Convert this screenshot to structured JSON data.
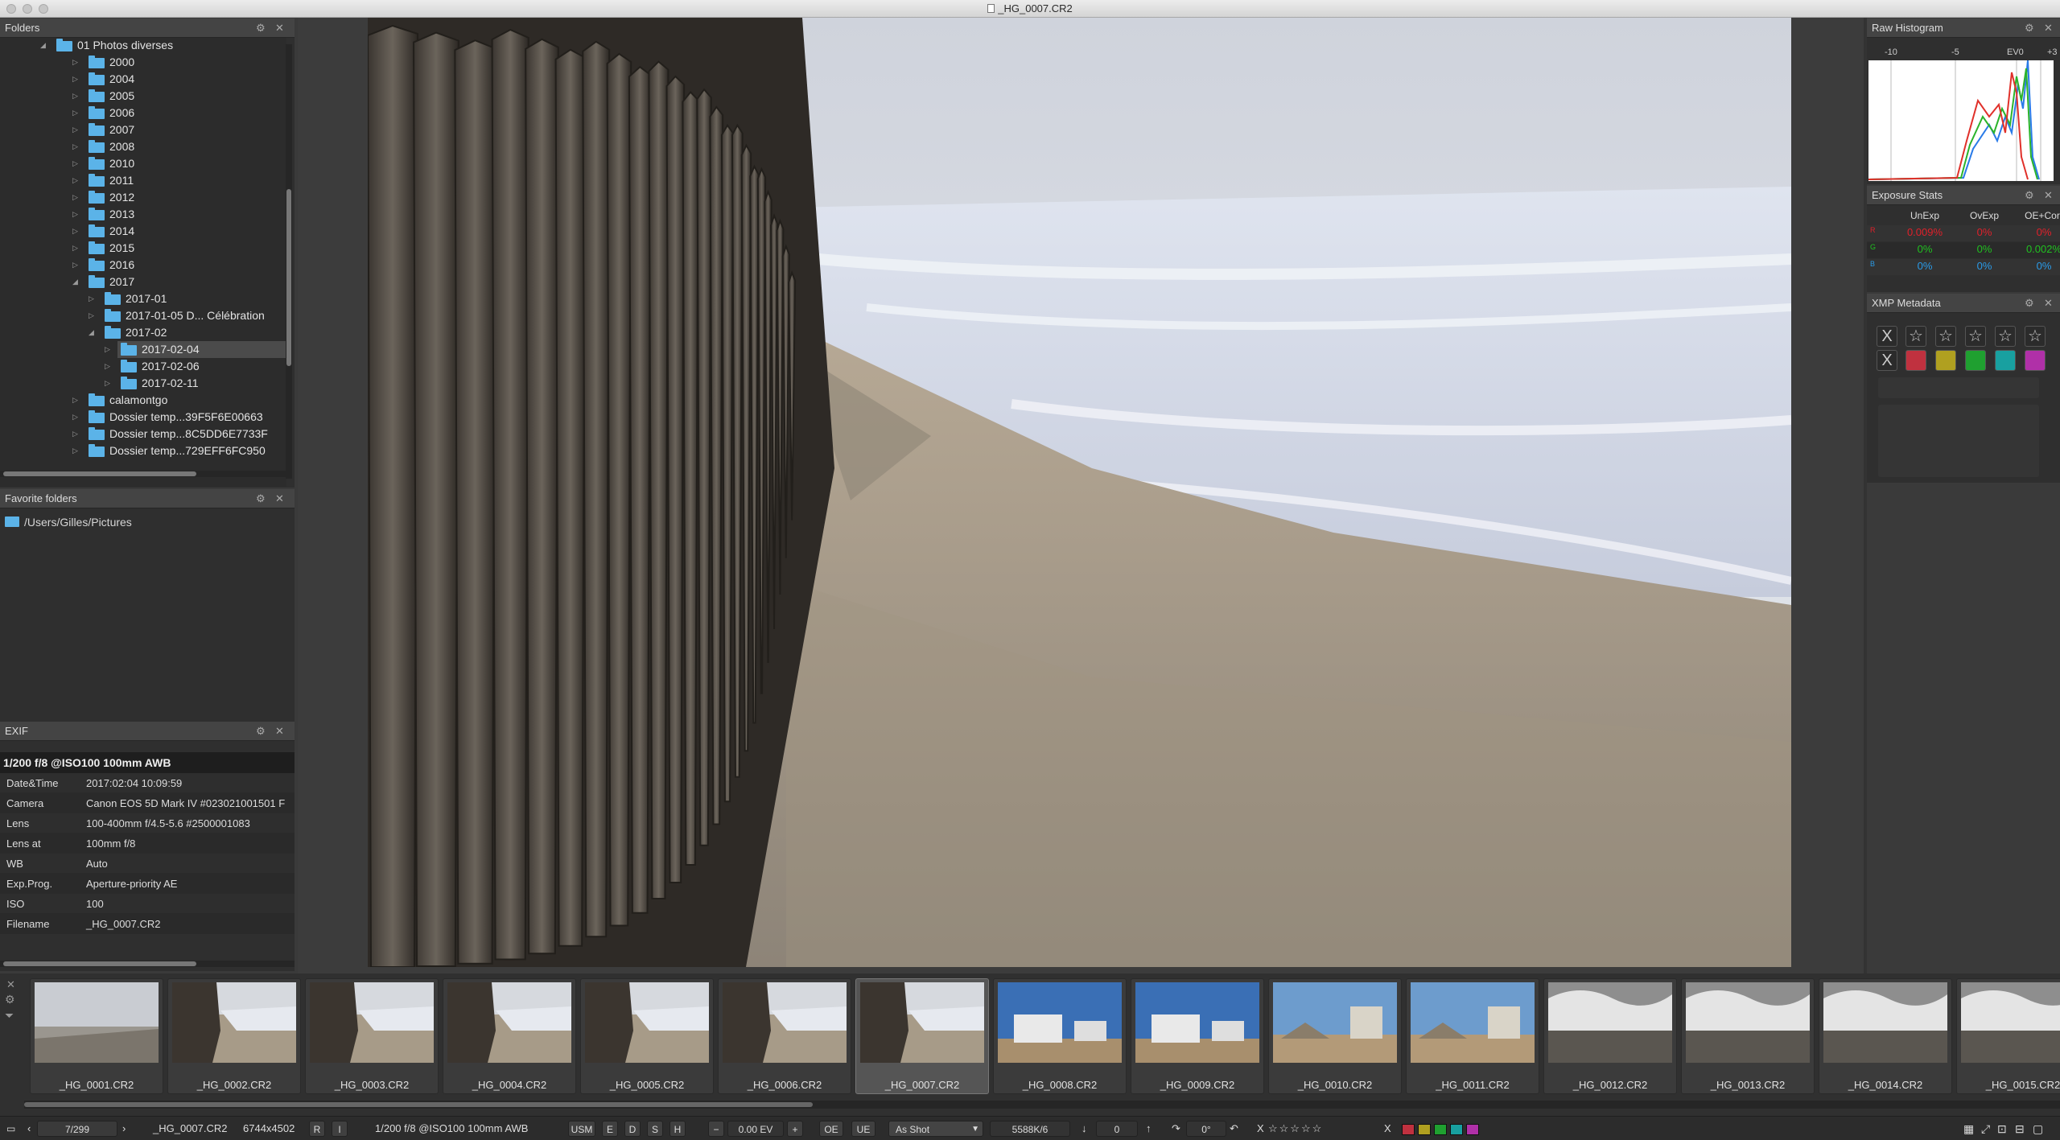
{
  "window": {
    "title": "_HG_0007.CR2"
  },
  "folders": {
    "title": "Folders",
    "items": [
      {
        "name": "01 Photos diverses",
        "depth": 0,
        "state": "open"
      },
      {
        "name": "2000",
        "depth": 1,
        "state": "closed"
      },
      {
        "name": "2004",
        "depth": 1,
        "state": "closed"
      },
      {
        "name": "2005",
        "depth": 1,
        "state": "closed"
      },
      {
        "name": "2006",
        "depth": 1,
        "state": "closed"
      },
      {
        "name": "2007",
        "depth": 1,
        "state": "closed"
      },
      {
        "name": "2008",
        "depth": 1,
        "state": "closed"
      },
      {
        "name": "2010",
        "depth": 1,
        "state": "closed"
      },
      {
        "name": "2011",
        "depth": 1,
        "state": "closed"
      },
      {
        "name": "2012",
        "depth": 1,
        "state": "closed"
      },
      {
        "name": "2013",
        "depth": 1,
        "state": "closed"
      },
      {
        "name": "2014",
        "depth": 1,
        "state": "closed"
      },
      {
        "name": "2015",
        "depth": 1,
        "state": "closed"
      },
      {
        "name": "2016",
        "depth": 1,
        "state": "closed"
      },
      {
        "name": "2017",
        "depth": 1,
        "state": "open"
      },
      {
        "name": "2017-01",
        "depth": 2,
        "state": "closed"
      },
      {
        "name": "2017-01-05 D... Célébration",
        "depth": 2,
        "state": "closed"
      },
      {
        "name": "2017-02",
        "depth": 2,
        "state": "open"
      },
      {
        "name": "2017-02-04",
        "depth": 3,
        "state": "closed",
        "selected": true
      },
      {
        "name": "2017-02-06",
        "depth": 3,
        "state": "closed"
      },
      {
        "name": "2017-02-11",
        "depth": 3,
        "state": "closed"
      },
      {
        "name": "calamontgo",
        "depth": 1,
        "state": "closed"
      },
      {
        "name": "Dossier temp...39F5F6E00663",
        "depth": 1,
        "state": "closed"
      },
      {
        "name": "Dossier temp...8C5DD6E7733F",
        "depth": 1,
        "state": "closed"
      },
      {
        "name": "Dossier temp...729EFF6FC950",
        "depth": 1,
        "state": "closed"
      }
    ]
  },
  "favorites": {
    "title": "Favorite folders",
    "items": [
      "/Users/Gilles/Pictures"
    ]
  },
  "exif": {
    "title": "EXIF",
    "summary": "1/200 f/8 @ISO100 100mm AWB",
    "rows": [
      {
        "k": "Date&Time",
        "v": "2017:02:04 10:09:59"
      },
      {
        "k": "Camera",
        "v": "Canon EOS 5D Mark IV #023021001501 F"
      },
      {
        "k": "Lens",
        "v": "100-400mm f/4.5-5.6 #2500001083"
      },
      {
        "k": "Lens at",
        "v": "100mm f/8"
      },
      {
        "k": "WB",
        "v": "Auto"
      },
      {
        "k": "Exp.Prog.",
        "v": "Aperture-priority AE"
      },
      {
        "k": "ISO",
        "v": "100"
      },
      {
        "k": "Filename",
        "v": "_HG_0007.CR2"
      }
    ]
  },
  "histogram": {
    "title": "Raw Histogram",
    "ticks": [
      "-10",
      "-5",
      "EV0",
      "+3"
    ]
  },
  "exposure": {
    "title": "Exposure Stats",
    "cols": [
      "UnExp",
      "OvExp",
      "OE+Corr"
    ],
    "rows": [
      {
        "ch": "R",
        "color": "#e0202a",
        "vals": [
          "0.009%",
          "0%",
          "0%"
        ]
      },
      {
        "ch": "G",
        "color": "#20c020",
        "vals": [
          "0%",
          "0%",
          "0.002%"
        ]
      },
      {
        "ch": "B",
        "color": "#2a9be8",
        "vals": [
          "0%",
          "0%",
          "0%"
        ]
      }
    ]
  },
  "xmp": {
    "title": "XMP Metadata",
    "reject": "X",
    "star": "☆",
    "colors": [
      "#c0313f",
      "#b0a020",
      "#1fa030",
      "#18a0a0",
      "#b030a8"
    ]
  },
  "filmstrip": [
    {
      "name": "_HG_0001.CR2",
      "kind": "sea"
    },
    {
      "name": "_HG_0002.CR2",
      "kind": "fence"
    },
    {
      "name": "_HG_0003.CR2",
      "kind": "fence"
    },
    {
      "name": "_HG_0004.CR2",
      "kind": "fence"
    },
    {
      "name": "_HG_0005.CR2",
      "kind": "fence"
    },
    {
      "name": "_HG_0006.CR2",
      "kind": "fence"
    },
    {
      "name": "_HG_0007.CR2",
      "kind": "fence",
      "selected": true
    },
    {
      "name": "_HG_0008.CR2",
      "kind": "blue"
    },
    {
      "name": "_HG_0009.CR2",
      "kind": "blue"
    },
    {
      "name": "_HG_0010.CR2",
      "kind": "house"
    },
    {
      "name": "_HG_0011.CR2",
      "kind": "house"
    },
    {
      "name": "_HG_0012.CR2",
      "kind": "cloud"
    },
    {
      "name": "_HG_0013.CR2",
      "kind": "cloud"
    },
    {
      "name": "_HG_0014.CR2",
      "kind": "cloud"
    },
    {
      "name": "_HG_0015.CR2",
      "kind": "cloud"
    }
  ],
  "status": {
    "counter": "7/299",
    "filename": "_HG_0007.CR2",
    "size": "6744x4502",
    "r": "R",
    "i": "I",
    "shot": "1/200 f/8 @ISO100 100mm AWB",
    "usm": "USM",
    "e": "E",
    "d": "D",
    "s": "S",
    "h": "H",
    "minus": "−",
    "ev": "0.00 EV",
    "plus": "+",
    "oe": "OE",
    "ue": "UE",
    "wb": "As Shot",
    "kelvin": "5588K/6",
    "down": "↓",
    "tint": "0",
    "up": "↑",
    "rot": "0°",
    "reject": "X",
    "stars": "☆☆☆☆☆",
    "x2": "X"
  }
}
